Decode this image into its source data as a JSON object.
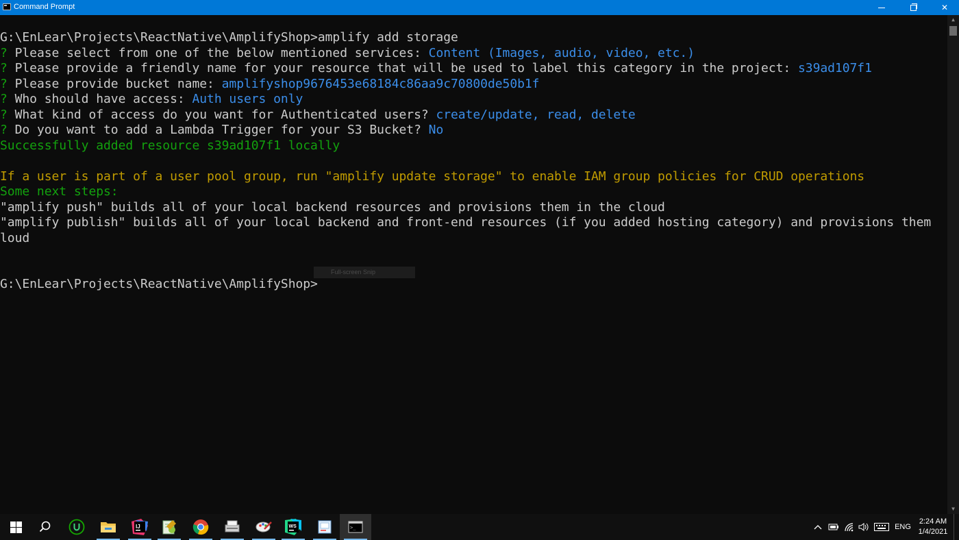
{
  "window": {
    "title": "Command Prompt"
  },
  "console": {
    "lines": [
      {
        "segments": [
          {
            "text": "G:\\EnLear\\Projects\\ReactNative\\AmplifyShop>amplify add storage",
            "color": "white"
          }
        ]
      },
      {
        "segments": [
          {
            "text": "? ",
            "color": "green"
          },
          {
            "text": "Please select from one of the below mentioned services: ",
            "color": "white"
          },
          {
            "text": "Content (Images, audio, video, etc.)",
            "color": "blue"
          }
        ]
      },
      {
        "segments": [
          {
            "text": "? ",
            "color": "green"
          },
          {
            "text": "Please provide a friendly name for your resource that will be used to label this category in the project: ",
            "color": "white"
          },
          {
            "text": "s39ad107f1",
            "color": "blue"
          }
        ]
      },
      {
        "segments": [
          {
            "text": "? ",
            "color": "green"
          },
          {
            "text": "Please provide bucket name: ",
            "color": "white"
          },
          {
            "text": "amplifyshop9676453e68184c86aa9c70800de50b1f",
            "color": "blue"
          }
        ]
      },
      {
        "segments": [
          {
            "text": "? ",
            "color": "green"
          },
          {
            "text": "Who should have access: ",
            "color": "white"
          },
          {
            "text": "Auth users only",
            "color": "blue"
          }
        ]
      },
      {
        "segments": [
          {
            "text": "? ",
            "color": "green"
          },
          {
            "text": "What kind of access do you want for Authenticated users? ",
            "color": "white"
          },
          {
            "text": "create/update, read, delete",
            "color": "blue"
          }
        ]
      },
      {
        "segments": [
          {
            "text": "? ",
            "color": "green"
          },
          {
            "text": "Do you want to add a Lambda Trigger for your S3 Bucket? ",
            "color": "white"
          },
          {
            "text": "No",
            "color": "blue"
          }
        ]
      },
      {
        "segments": [
          {
            "text": "Successfully added resource s39ad107f1 locally",
            "color": "green"
          }
        ]
      },
      {
        "segments": [
          {
            "text": "",
            "color": "white"
          }
        ]
      },
      {
        "segments": [
          {
            "text": "If a user is part of a user pool group, run \"amplify update storage\" to enable IAM group policies for CRUD operations",
            "color": "yellow"
          }
        ]
      },
      {
        "segments": [
          {
            "text": "Some next steps:",
            "color": "green"
          }
        ]
      },
      {
        "segments": [
          {
            "text": "\"amplify push\" builds all of your local backend resources and provisions them in the cloud",
            "color": "white"
          }
        ]
      },
      {
        "segments": [
          {
            "text": "\"amplify publish\" builds all of your local backend and front-end resources (if you added hosting category) and provisions them",
            "color": "white"
          }
        ]
      },
      {
        "segments": [
          {
            "text": "loud",
            "color": "white"
          }
        ]
      },
      {
        "segments": [
          {
            "text": "",
            "color": "white"
          }
        ]
      },
      {
        "segments": [
          {
            "text": "",
            "color": "white"
          }
        ]
      },
      {
        "segments": [
          {
            "text": "G:\\EnLear\\Projects\\ReactNative\\AmplifyShop>",
            "color": "white"
          }
        ]
      }
    ]
  },
  "snip_overlay": {
    "label": "Full-screen Snip"
  },
  "taskbar": {
    "apps": [
      {
        "name": "search-icon"
      },
      {
        "name": "upwork-icon"
      },
      {
        "name": "file-explorer-icon"
      },
      {
        "name": "intellij-idea-icon"
      },
      {
        "name": "notepad-plus-plus-icon"
      },
      {
        "name": "chrome-icon"
      },
      {
        "name": "scanner-app-icon"
      },
      {
        "name": "paint-app-icon"
      },
      {
        "name": "webstorm-icon"
      },
      {
        "name": "image-viewer-icon"
      },
      {
        "name": "command-prompt-icon"
      }
    ],
    "tray": {
      "language": "ENG",
      "time": "2:24 AM",
      "date": "1/4/2021"
    }
  },
  "colors": {
    "titlebar": "#0078d7",
    "console_background": "#0c0c0c",
    "white": "#cccccc",
    "blue": "#3b8eea",
    "green": "#13a10e",
    "yellow": "#c19c00"
  }
}
